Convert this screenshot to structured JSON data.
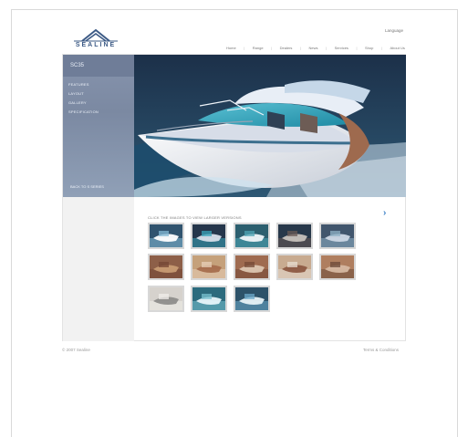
{
  "brand": {
    "name": "SEALINE",
    "logo_icon": "sail-icon",
    "accent": "#3d5b86"
  },
  "header": {
    "language_label": "Language",
    "nav": [
      "Home",
      "Range",
      "Dealers",
      "News",
      "Services",
      "Shop",
      "About Us"
    ]
  },
  "sidebar": {
    "title": "SC35",
    "items": [
      "FEATURES",
      "LAYOUT",
      "GALLERY",
      "SPECIFICATION"
    ],
    "back_label": "BACK TO S SERIES"
  },
  "gallery": {
    "caption": "CLICK THE IMAGES TO VIEW LARGER VERSIONS",
    "next_icon": "chevron-right-icon",
    "thumbs": [
      {
        "name": "thumb-1",
        "scene": "boat-side"
      },
      {
        "name": "thumb-2",
        "scene": "boat-dark"
      },
      {
        "name": "thumb-3",
        "scene": "boat-sea"
      },
      {
        "name": "thumb-4",
        "scene": "cockpit"
      },
      {
        "name": "thumb-5",
        "scene": "deck"
      },
      {
        "name": "thumb-6",
        "scene": "cabin-wood"
      },
      {
        "name": "thumb-7",
        "scene": "saloon"
      },
      {
        "name": "thumb-8",
        "scene": "bed"
      },
      {
        "name": "thumb-9",
        "scene": "galley"
      },
      {
        "name": "thumb-10",
        "scene": "interior"
      },
      {
        "name": "thumb-11",
        "scene": "bathroom"
      },
      {
        "name": "thumb-12",
        "scene": "aerial"
      },
      {
        "name": "thumb-13",
        "scene": "cruise"
      }
    ]
  },
  "footer": {
    "copyright": "© 2007 Sealine",
    "terms": "Terms & Conditions"
  }
}
